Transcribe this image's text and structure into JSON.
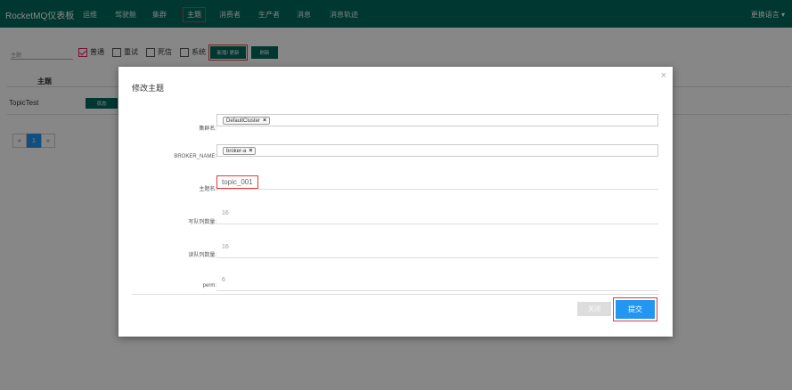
{
  "navbar": {
    "brand": "RocketMQ仪表板",
    "items": [
      "运维",
      "驾驶舱",
      "集群",
      "主题",
      "消费者",
      "生产者",
      "消息",
      "消息轨迹"
    ],
    "active_index": 3,
    "language": "更换语言 ▾"
  },
  "filter": {
    "search_placeholder": "主题",
    "checkboxes": [
      {
        "label": "普通",
        "checked": true
      },
      {
        "label": "重试",
        "checked": false
      },
      {
        "label": "死信",
        "checked": false
      },
      {
        "label": "系统",
        "checked": false
      }
    ],
    "add_update_label": "新增/ 更新",
    "refresh_label": "刷新"
  },
  "table": {
    "header": "主题",
    "rows": [
      {
        "topic": "TopicTest",
        "status_label": "状态"
      }
    ]
  },
  "pagination": {
    "prev": "«",
    "current": "1",
    "next": "»"
  },
  "modal": {
    "title": "修改主题",
    "close_icon": "×",
    "cluster_label": "集群名:",
    "cluster_tag": "DefaultCluster",
    "broker_label": "BROKER_NAME:",
    "broker_tag": "broker-a",
    "topic_label": "主题名:",
    "topic_value": "topic_001",
    "write_queue_label": "写队列数量:",
    "write_queue_value": "16",
    "read_queue_label": "读队列数量:",
    "read_queue_value": "16",
    "perm_label": "perm:",
    "perm_value": "6",
    "close_button": "关闭",
    "submit_button": "提交"
  },
  "colors": {
    "navbar": "#00695c",
    "submit": "#2196f3",
    "highlight": "#e53935"
  }
}
